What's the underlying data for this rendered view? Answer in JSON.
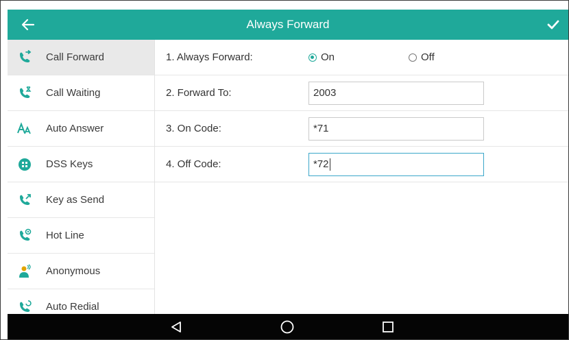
{
  "header": {
    "title": "Always Forward",
    "back_icon": "back-arrow-icon",
    "confirm_icon": "checkmark-icon"
  },
  "colors": {
    "accent": "#1fa99a",
    "nav_background": "#050505",
    "sidebar_active": "#e9e9e9"
  },
  "sidebar": {
    "items": [
      {
        "label": "Call Forward",
        "icon": "call-forward-icon",
        "active": true
      },
      {
        "label": "Call Waiting",
        "icon": "call-waiting-icon",
        "active": false
      },
      {
        "label": "Auto Answer",
        "icon": "auto-answer-icon",
        "active": false
      },
      {
        "label": "DSS Keys",
        "icon": "dss-keys-icon",
        "active": false
      },
      {
        "label": "Key as Send",
        "icon": "key-as-send-icon",
        "active": false
      },
      {
        "label": "Hot Line",
        "icon": "hot-line-icon",
        "active": false
      },
      {
        "label": "Anonymous",
        "icon": "anonymous-icon",
        "active": false
      },
      {
        "label": "Auto Redial",
        "icon": "auto-redial-icon",
        "active": false
      }
    ]
  },
  "form": {
    "always_forward": {
      "label": "1. Always Forward:",
      "on_label": "On",
      "off_label": "Off",
      "selected": "On"
    },
    "forward_to": {
      "label": "2. Forward To:",
      "value": "2003"
    },
    "on_code": {
      "label": "3. On Code:",
      "value": "*71"
    },
    "off_code": {
      "label": "4. Off Code:",
      "value": "*72"
    }
  },
  "navbar": {
    "back_icon": "nav-back-triangle-icon",
    "home_icon": "nav-home-circle-icon",
    "recents_icon": "nav-recents-square-icon"
  }
}
